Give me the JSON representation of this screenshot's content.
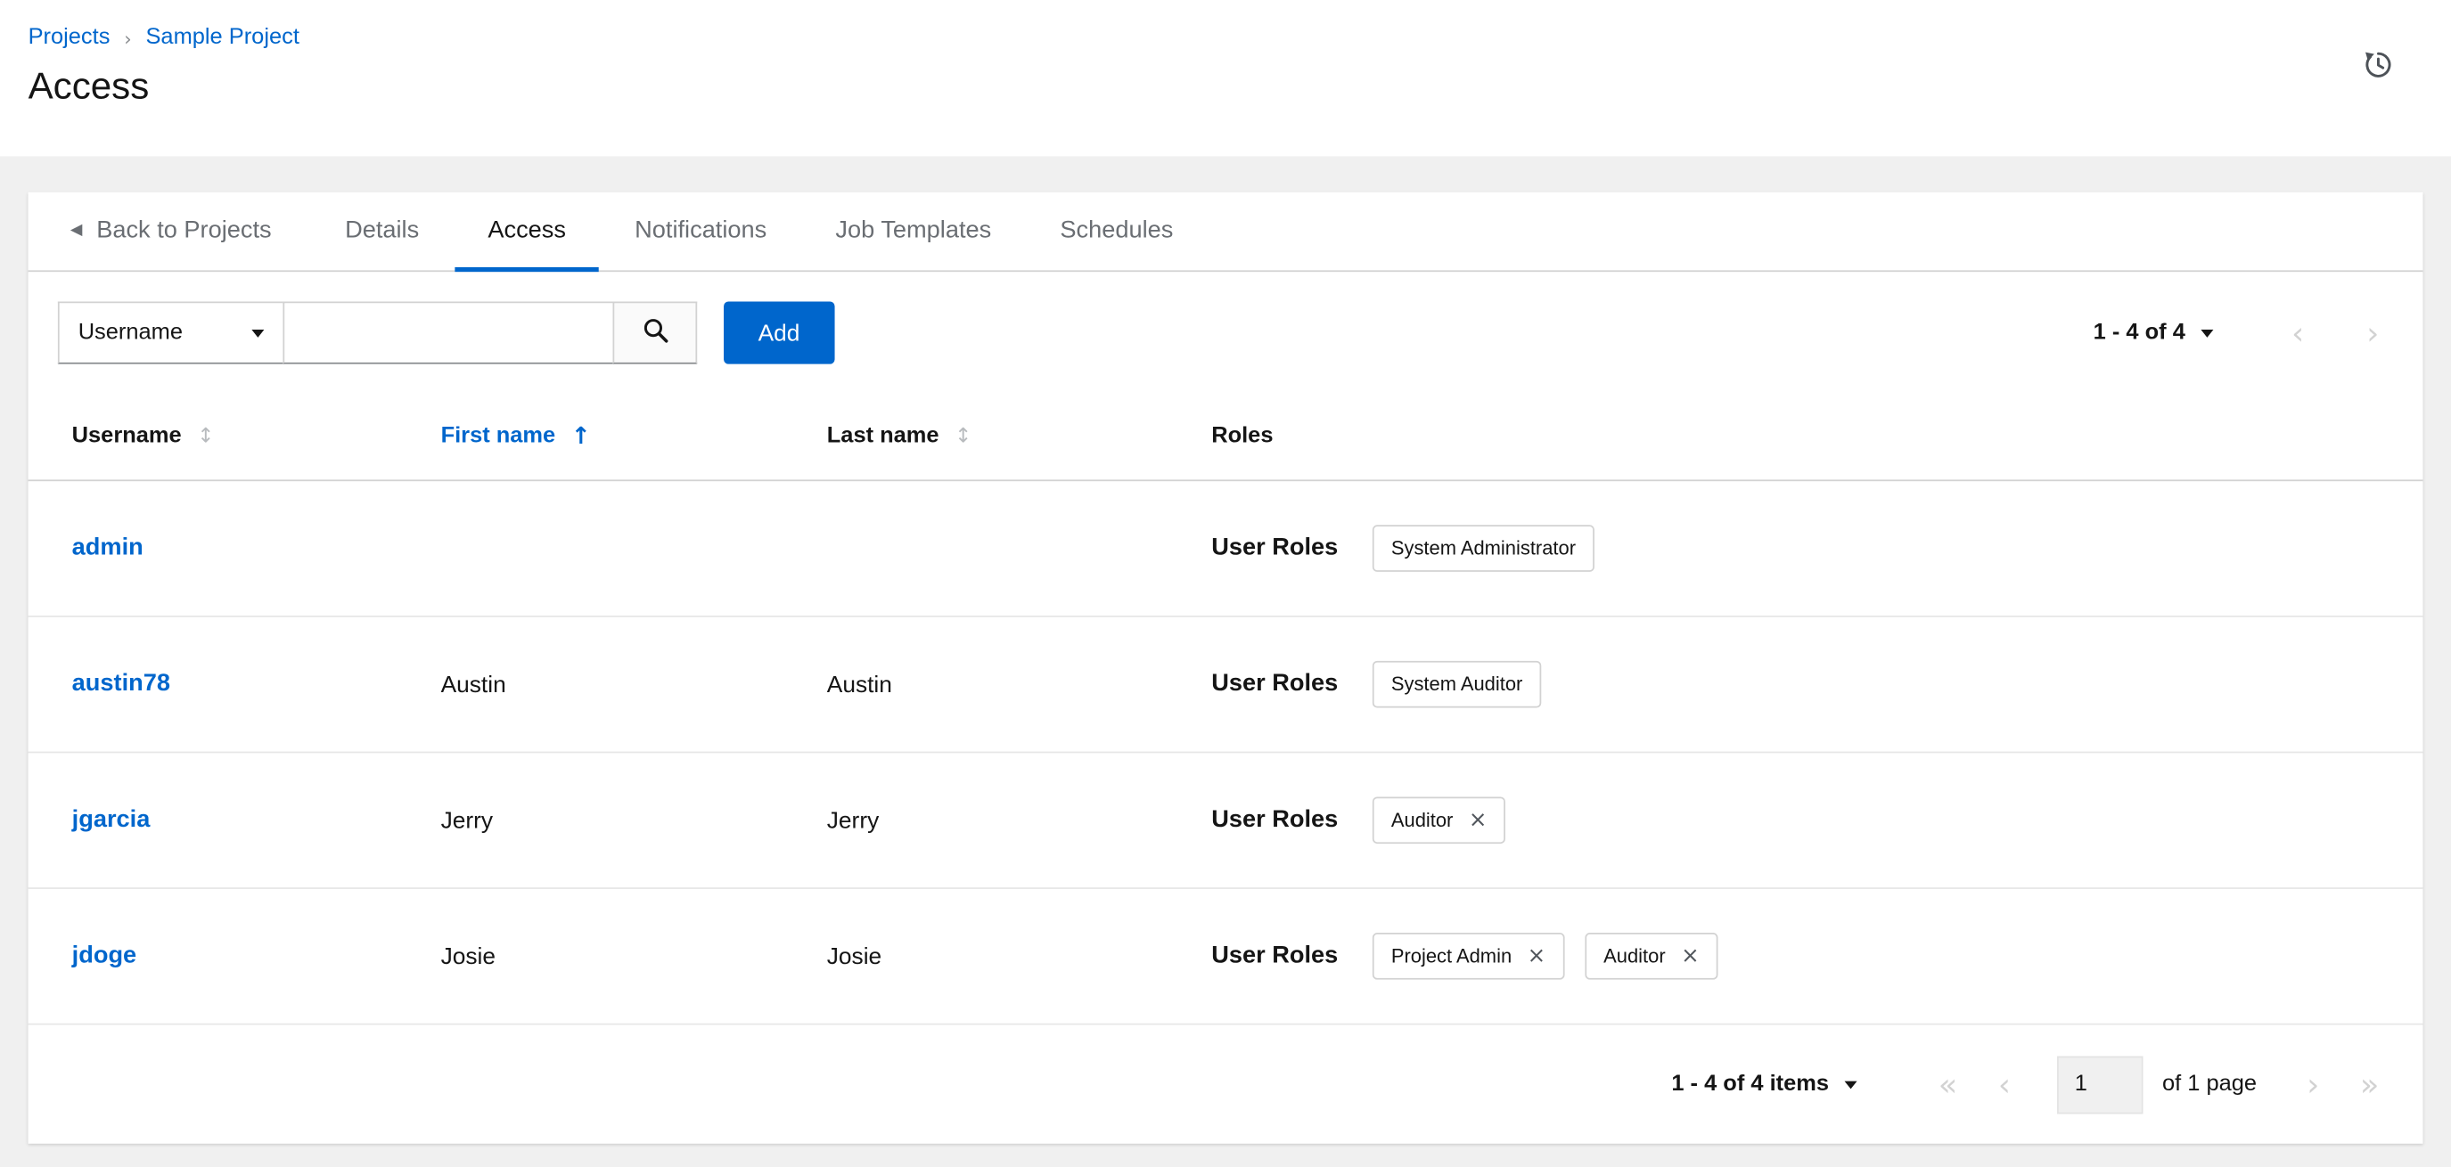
{
  "breadcrumb": {
    "projects": "Projects",
    "separator": "›",
    "current": "Sample Project"
  },
  "page": {
    "title": "Access"
  },
  "tabs": {
    "back_label": "Back to Projects",
    "items": [
      {
        "label": "Details",
        "active": false
      },
      {
        "label": "Access",
        "active": true
      },
      {
        "label": "Notifications",
        "active": false
      },
      {
        "label": "Job Templates",
        "active": false
      },
      {
        "label": "Schedules",
        "active": false
      }
    ]
  },
  "toolbar": {
    "filter_dropdown": {
      "selected": "Username"
    },
    "search": {
      "value": ""
    },
    "add_label": "Add",
    "pagination": {
      "range": "1 - 4 of 4"
    }
  },
  "table": {
    "columns": [
      {
        "label": "Username",
        "sort": "none"
      },
      {
        "label": "First name",
        "sort": "asc"
      },
      {
        "label": "Last name",
        "sort": "none"
      },
      {
        "label": "Roles",
        "sort": null
      }
    ],
    "user_roles_label": "User Roles",
    "rows": [
      {
        "username": "admin",
        "first_name": "",
        "last_name": "",
        "roles": [
          {
            "label": "System Administrator",
            "removable": false
          }
        ]
      },
      {
        "username": "austin78",
        "first_name": "Austin",
        "last_name": "Austin",
        "roles": [
          {
            "label": "System Auditor",
            "removable": false
          }
        ]
      },
      {
        "username": "jgarcia",
        "first_name": "Jerry",
        "last_name": "Jerry",
        "roles": [
          {
            "label": "Auditor",
            "removable": true
          }
        ]
      },
      {
        "username": "jdoge",
        "first_name": "Josie",
        "last_name": "Josie",
        "roles": [
          {
            "label": "Project Admin",
            "removable": true
          },
          {
            "label": "Auditor",
            "removable": true
          }
        ]
      }
    ]
  },
  "pagination": {
    "items_range": "1 - 4 of 4 items",
    "current_page": "1",
    "page_label": "of 1 page"
  },
  "icons": {
    "angle_left": "‹",
    "angle_right": "›",
    "angle_double_left": "«",
    "angle_double_right": "»",
    "sort_both": "↕",
    "sort_up": "↑",
    "back_arrow": "◀",
    "close": "×"
  },
  "colors": {
    "accent": "#0066cc",
    "link": "#0066cc",
    "active_tab_underline": "#0066cc",
    "background": "#f0f0f0"
  }
}
